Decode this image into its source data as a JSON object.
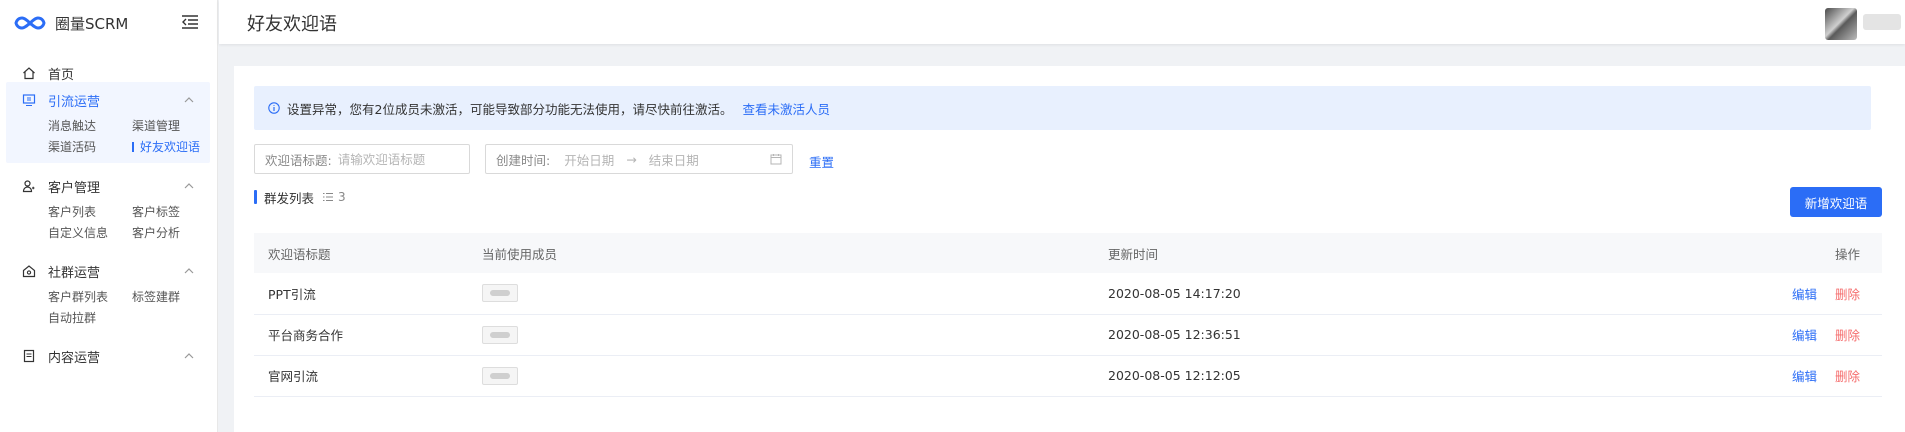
{
  "brand": {
    "name": "圈量SCRM"
  },
  "sidebar": {
    "home": "首页",
    "groups": [
      {
        "label": "引流运营",
        "active": true,
        "items": [
          "消息触达",
          "渠道管理",
          "渠道活码",
          "好友欢迎语"
        ],
        "current": "好友欢迎语"
      },
      {
        "label": "客户管理",
        "items": [
          "客户列表",
          "客户标签",
          "自定义信息",
          "客户分析"
        ]
      },
      {
        "label": "社群运营",
        "items": [
          "客户群列表",
          "标签建群",
          "自动拉群"
        ]
      },
      {
        "label": "内容运营",
        "items": []
      }
    ]
  },
  "header": {
    "title": "好友欢迎语"
  },
  "alert": {
    "text": "设置异常，您有2位成员未激活，可能导致部分功能无法使用，请尽快前往激活。",
    "link": "查看未激活人员"
  },
  "filters": {
    "title_label": "欢迎语标题:",
    "title_placeholder": "请输欢迎语标题",
    "date_label": "创建时间:",
    "start_placeholder": "开始日期",
    "end_placeholder": "结束日期",
    "separator": "→",
    "reset": "重置"
  },
  "list": {
    "title": "群发列表",
    "count": "3",
    "add_button": "新增欢迎语"
  },
  "table": {
    "columns": [
      "欢迎语标题",
      "当前使用成员",
      "更新时间",
      "操作"
    ],
    "rows": [
      {
        "title": "PPT引流",
        "updated": "2020-08-05 14:17:20",
        "edit": "编辑",
        "delete": "删除"
      },
      {
        "title": "平台商务合作",
        "updated": "2020-08-05 12:36:51",
        "edit": "编辑",
        "delete": "删除"
      },
      {
        "title": "官网引流",
        "updated": "2020-08-05 12:12:05",
        "edit": "编辑",
        "delete": "删除"
      }
    ]
  },
  "colors": {
    "primary": "#2b6df6",
    "danger": "#f56c6c",
    "alert_bg": "#e8f0fe"
  }
}
